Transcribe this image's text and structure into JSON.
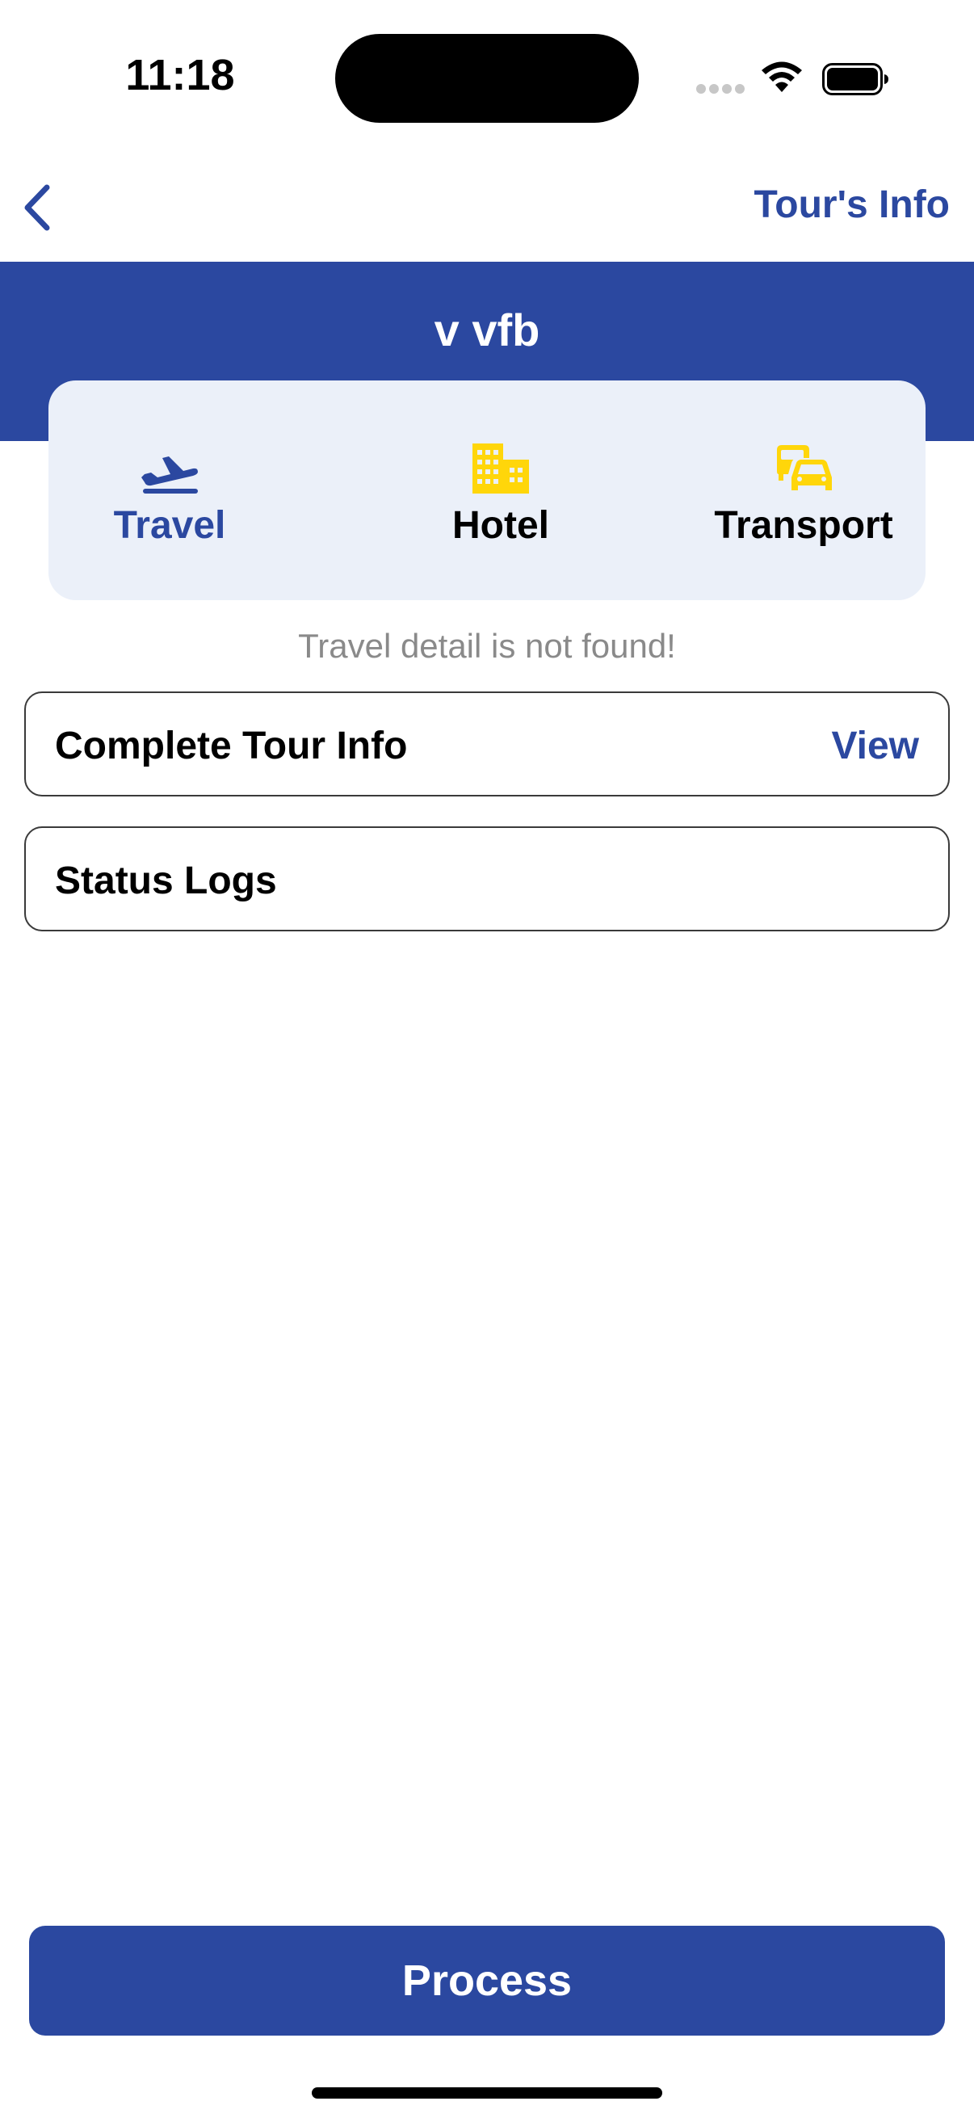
{
  "status_bar": {
    "time": "11:18"
  },
  "nav": {
    "back_icon": "chevron-left-icon",
    "right_link": "Tour's Info"
  },
  "header": {
    "title": "v vfb"
  },
  "tabs": [
    {
      "label": "Travel",
      "icon": "airplane-departure-icon",
      "selected": true
    },
    {
      "label": "Hotel",
      "icon": "building-icon",
      "selected": false
    },
    {
      "label": "Transport",
      "icon": "bus-car-icon",
      "selected": false
    }
  ],
  "empty_message": "Travel detail is not found!",
  "rows": {
    "tour_info": {
      "title": "Complete Tour Info",
      "action": "View"
    },
    "status_logs": {
      "title": "Status Logs"
    }
  },
  "process_button": {
    "label": "Process"
  },
  "colors": {
    "accent": "#2b48a0",
    "tab_card_bg": "#ebf0f9",
    "icon_yellow": "#ffd60a",
    "muted_text": "#8a8a8a"
  }
}
